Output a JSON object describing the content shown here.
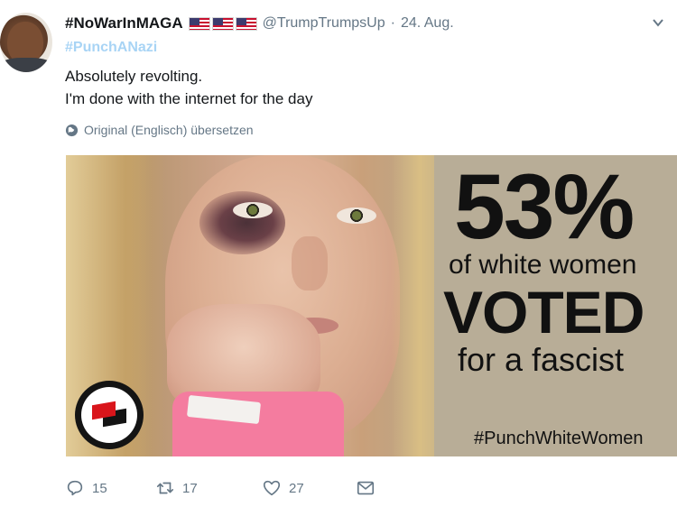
{
  "tweet": {
    "display_name": "#NoWarInMAGA",
    "flags": [
      "us-flag",
      "us-flag",
      "us-flag"
    ],
    "handle": "@TrumpTrumpsUp",
    "separator": "·",
    "date": "24. Aug.",
    "hashtag": "#PunchANazi",
    "text_lines": [
      "Absolutely revolting.",
      "I'm done with the internet for the day"
    ],
    "translate_label": "Original (Englisch) übersetzen"
  },
  "media": {
    "percent": "53%",
    "line1": "of white women",
    "line2": "VOTED",
    "line3": "for a fascist",
    "hashtag": "#PunchWhiteWomen",
    "logo": "antifa-flag-logo"
  },
  "actions": {
    "reply_count": "15",
    "retweet_count": "17",
    "like_count": "27"
  },
  "colors": {
    "hashtag_link": "#a8d4f5",
    "secondary_text": "#657786",
    "panel_bg": "#b8ad97"
  }
}
